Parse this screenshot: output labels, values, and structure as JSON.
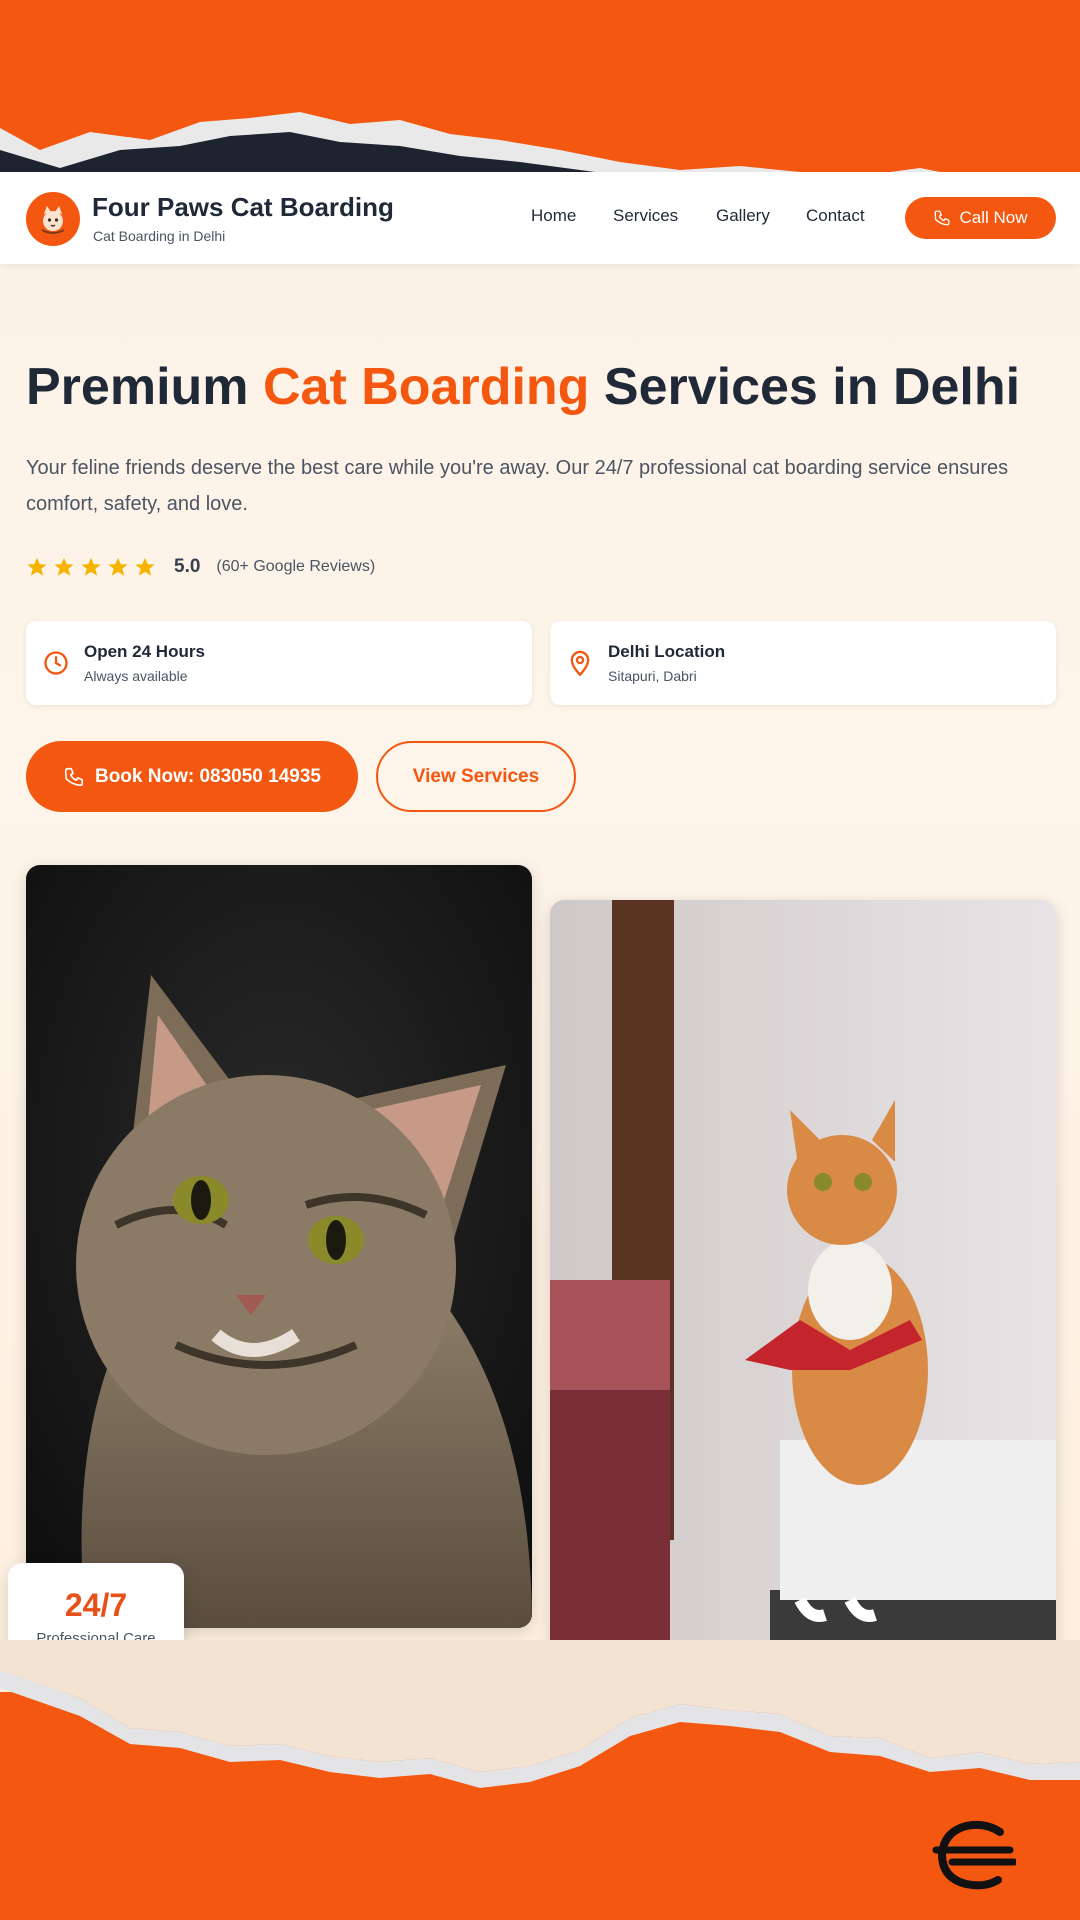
{
  "colors": {
    "accent": "#f4570f",
    "text": "#1f2937",
    "muted": "#4b5563",
    "star": "#f5b400"
  },
  "header": {
    "brand_name": "Four Paws Cat Boarding",
    "brand_sub": "Cat Boarding in Delhi",
    "nav": {
      "home": "Home",
      "services": "Services",
      "gallery": "Gallery",
      "contact": "Contact"
    },
    "call_label": "Call Now"
  },
  "hero": {
    "title_pre": "Premium ",
    "title_accent": "Cat Boarding",
    "title_post": " Services in Delhi",
    "description": "Your feline friends deserve the best care while you're away. Our 24/7 professional cat boarding service ensures comfort, safety, and love.",
    "rating": {
      "stars": 5,
      "value": "5.0",
      "count": "(60+ Google Reviews)"
    },
    "info_cards": [
      {
        "icon": "clock-icon",
        "title": "Open 24 Hours",
        "subtitle": "Always available"
      },
      {
        "icon": "location-pin-icon",
        "title": "Delhi Location",
        "subtitle": "Sitapuri, Dabri"
      }
    ],
    "book_label": "Book Now: 083050 14935",
    "services_label": "View Services"
  },
  "gallery": {
    "photos": [
      "tabby-kitten-photo",
      "orange-cat-with-bandana-photo"
    ]
  },
  "badge": {
    "value": "24/7",
    "label": "Professional Care"
  }
}
